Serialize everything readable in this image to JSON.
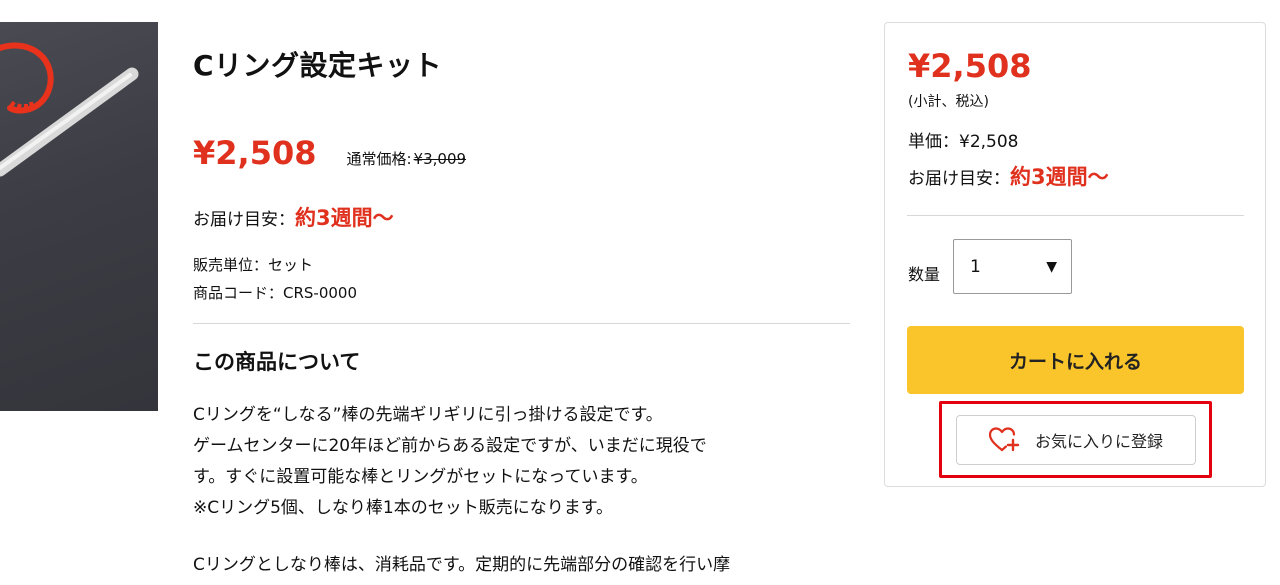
{
  "product": {
    "title": "Cリング設定キット",
    "price": "¥2,508",
    "regular_label": "通常価格:",
    "regular_price": "¥3,009",
    "delivery_label": "お届け目安：",
    "delivery_value": "約3週間〜",
    "unit_line": "販売単位：セット",
    "code_line": "商品コード：CRS-0000"
  },
  "about": {
    "heading": "この商品について",
    "lines": [
      "Cリングを“しなる”棒の先端ギリギリに引っ掛ける設定です。",
      "ゲームセンターに20年ほど前からある設定ですが、いまだに現役で",
      "す。すぐに設置可能な棒とリングがセットになっています。",
      "※Cリング5個、しなり棒1本のセット販売になります。"
    ],
    "line5": "Cリングとしなり棒は、消耗品です。定期的に先端部分の確認を行い摩"
  },
  "buybox": {
    "price": "¥2,508",
    "note": "(小計、税込)",
    "unit_price": "単価：¥2,508",
    "delivery_label": "お届け目安：",
    "delivery_value": "約3週間〜",
    "qty_label": "数量",
    "qty_value": "1",
    "qty_arrow": "▼",
    "cart_button": "カートに入れる",
    "favorite_button": "お気に入りに登録"
  },
  "colors": {
    "accent_red": "#e0301e",
    "cart_yellow": "#f9c52b",
    "highlight_red": "#e3000f"
  },
  "icons": {
    "favorite": "heart-plus-icon",
    "dropdown": "triangle-down-icon"
  }
}
